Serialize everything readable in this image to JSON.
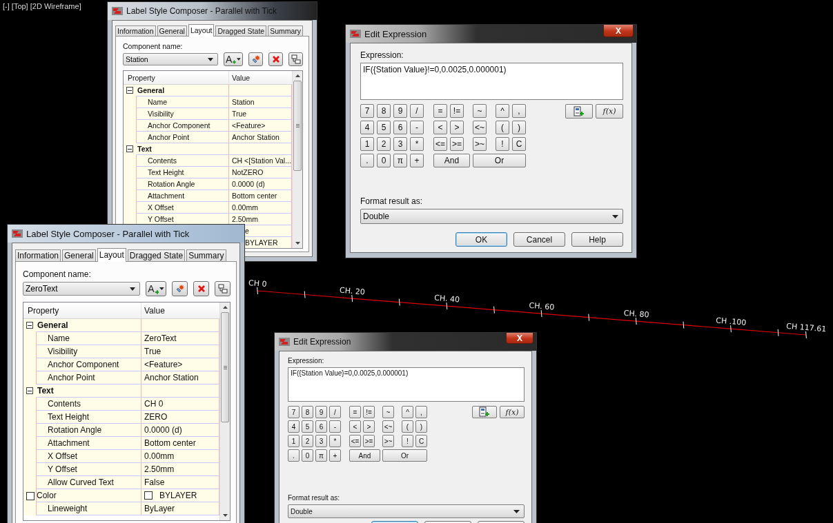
{
  "viewport_label": "[-] [Top] [2D Wireframe]",
  "alignment": {
    "labels": [
      {
        "text": "CH 0"
      },
      {
        "text": "CH. 20"
      },
      {
        "text": "CH. 40"
      },
      {
        "text": "CH. 60"
      },
      {
        "text": "CH. 80"
      },
      {
        "text": "CH .100"
      },
      {
        "text": "CH 117.61"
      }
    ]
  },
  "label_style_composers": [
    {
      "title": "Label Style Composer - Parallel with Tick",
      "tabs": [
        {
          "label": "Information",
          "selected": false
        },
        {
          "label": "General",
          "selected": false
        },
        {
          "label": "Layout",
          "selected": true
        },
        {
          "label": "Dragged State",
          "selected": false
        },
        {
          "label": "Summary",
          "selected": false
        }
      ],
      "component_label": "Component name:",
      "component": "Station",
      "add_glyph": "A",
      "columns": [
        "Property",
        "Value"
      ],
      "groups": [
        {
          "name": "General",
          "expanded": true,
          "children": [
            {
              "kind": "text",
              "property": "Name",
              "value": "Station"
            },
            {
              "kind": "text",
              "property": "Visibility",
              "value": "True"
            },
            {
              "kind": "text",
              "property": "Anchor Component",
              "value": "<Feature>"
            },
            {
              "kind": "text",
              "property": "Anchor Point",
              "value": "Anchor Station"
            }
          ]
        },
        {
          "name": "Text",
          "expanded": true,
          "children": [
            {
              "kind": "text",
              "property": "Contents",
              "value": "CH <[Station Val..."
            },
            {
              "kind": "text",
              "property": "Text Height",
              "value": "NotZERO"
            },
            {
              "kind": "text",
              "property": "Rotation Angle",
              "value": "0.0000 (d)"
            },
            {
              "kind": "text",
              "property": "Attachment",
              "value": "Bottom center"
            },
            {
              "kind": "text",
              "property": "X Offset",
              "value": "0.00mm"
            },
            {
              "kind": "text",
              "property": "Y Offset",
              "value": "2.50mm"
            },
            {
              "kind": "partial",
              "value": "e"
            },
            {
              "kind": "partial",
              "value": "BYLAYER"
            }
          ]
        }
      ]
    },
    {
      "title": "Label Style Composer - Parallel with Tick",
      "tabs": [
        {
          "label": "Information",
          "selected": false
        },
        {
          "label": "General",
          "selected": false
        },
        {
          "label": "Layout",
          "selected": true
        },
        {
          "label": "Dragged State",
          "selected": false
        },
        {
          "label": "Summary",
          "selected": false
        }
      ],
      "component_label": "Component name:",
      "component": "ZeroText",
      "add_glyph": "A",
      "columns": [
        "Property",
        "Value"
      ],
      "groups": [
        {
          "name": "General",
          "expanded": true,
          "children": [
            {
              "kind": "text",
              "property": "Name",
              "value": "ZeroText"
            },
            {
              "kind": "text",
              "property": "Visibility",
              "value": "True"
            },
            {
              "kind": "text",
              "property": "Anchor Component",
              "value": "<Feature>"
            },
            {
              "kind": "text",
              "property": "Anchor Point",
              "value": "Anchor Station"
            }
          ]
        },
        {
          "name": "Text",
          "expanded": true,
          "children": [
            {
              "kind": "text",
              "property": "Contents",
              "value": "CH 0"
            },
            {
              "kind": "text",
              "property": "Text Height",
              "value": "ZERO"
            },
            {
              "kind": "text",
              "property": "Rotation Angle",
              "value": "0.0000 (d)"
            },
            {
              "kind": "text",
              "property": "Attachment",
              "value": "Bottom center"
            },
            {
              "kind": "text",
              "property": "X Offset",
              "value": "0.00mm"
            },
            {
              "kind": "text",
              "property": "Y Offset",
              "value": "2.50mm"
            },
            {
              "kind": "text",
              "property": "Allow Curved Text",
              "value": "False"
            },
            {
              "kind": "color",
              "property": "Color",
              "value": "BYLAYER"
            },
            {
              "kind": "text",
              "property": "Lineweight",
              "value": "ByLayer"
            }
          ]
        }
      ]
    }
  ],
  "expression_dialogs": [
    {
      "title": "Edit Expression",
      "expression_label": "Expression:",
      "expression": "IF({Station Value}!=0,0.0025,0.000001)",
      "function_glyph": "f(x)",
      "keypad": [
        [
          "7",
          "8",
          "9",
          "/",
          "=",
          "!=",
          "~",
          "^",
          ","
        ],
        [
          "4",
          "5",
          "6",
          "-",
          "<",
          ">",
          "<~",
          "(",
          ")"
        ],
        [
          "1",
          "2",
          "3",
          "*",
          "<=",
          ">=",
          ">~",
          "!",
          "C"
        ],
        [
          ".",
          "0",
          "π",
          "+",
          "And",
          "Or"
        ]
      ],
      "format_label": "Format result as:",
      "format": "Double",
      "buttons": [
        {
          "label": "OK",
          "kind": "default"
        },
        {
          "label": "Cancel",
          "kind": "plain"
        },
        {
          "label": "Help",
          "kind": "plain"
        }
      ]
    },
    {
      "title": "Edit Expression",
      "expression_label": "Expression:",
      "expression": "IF({Station Value}=0,0.0025,0.000001)",
      "function_glyph": "f(x)",
      "keypad": [
        [
          "7",
          "8",
          "9",
          "/",
          "=",
          "!=",
          "~",
          "^",
          ","
        ],
        [
          "4",
          "5",
          "6",
          "-",
          "<",
          ">",
          "<~",
          "(",
          ")"
        ],
        [
          "1",
          "2",
          "3",
          "*",
          "<=",
          ">=",
          ">~",
          "!",
          "C"
        ],
        [
          ".",
          "0",
          "π",
          "+",
          "And",
          "Or"
        ]
      ],
      "format_label": "Format result as:",
      "format": "Double",
      "buttons": [
        {
          "kind": "default"
        },
        {
          "kind": "plain"
        },
        {
          "kind": "plain"
        }
      ]
    }
  ]
}
